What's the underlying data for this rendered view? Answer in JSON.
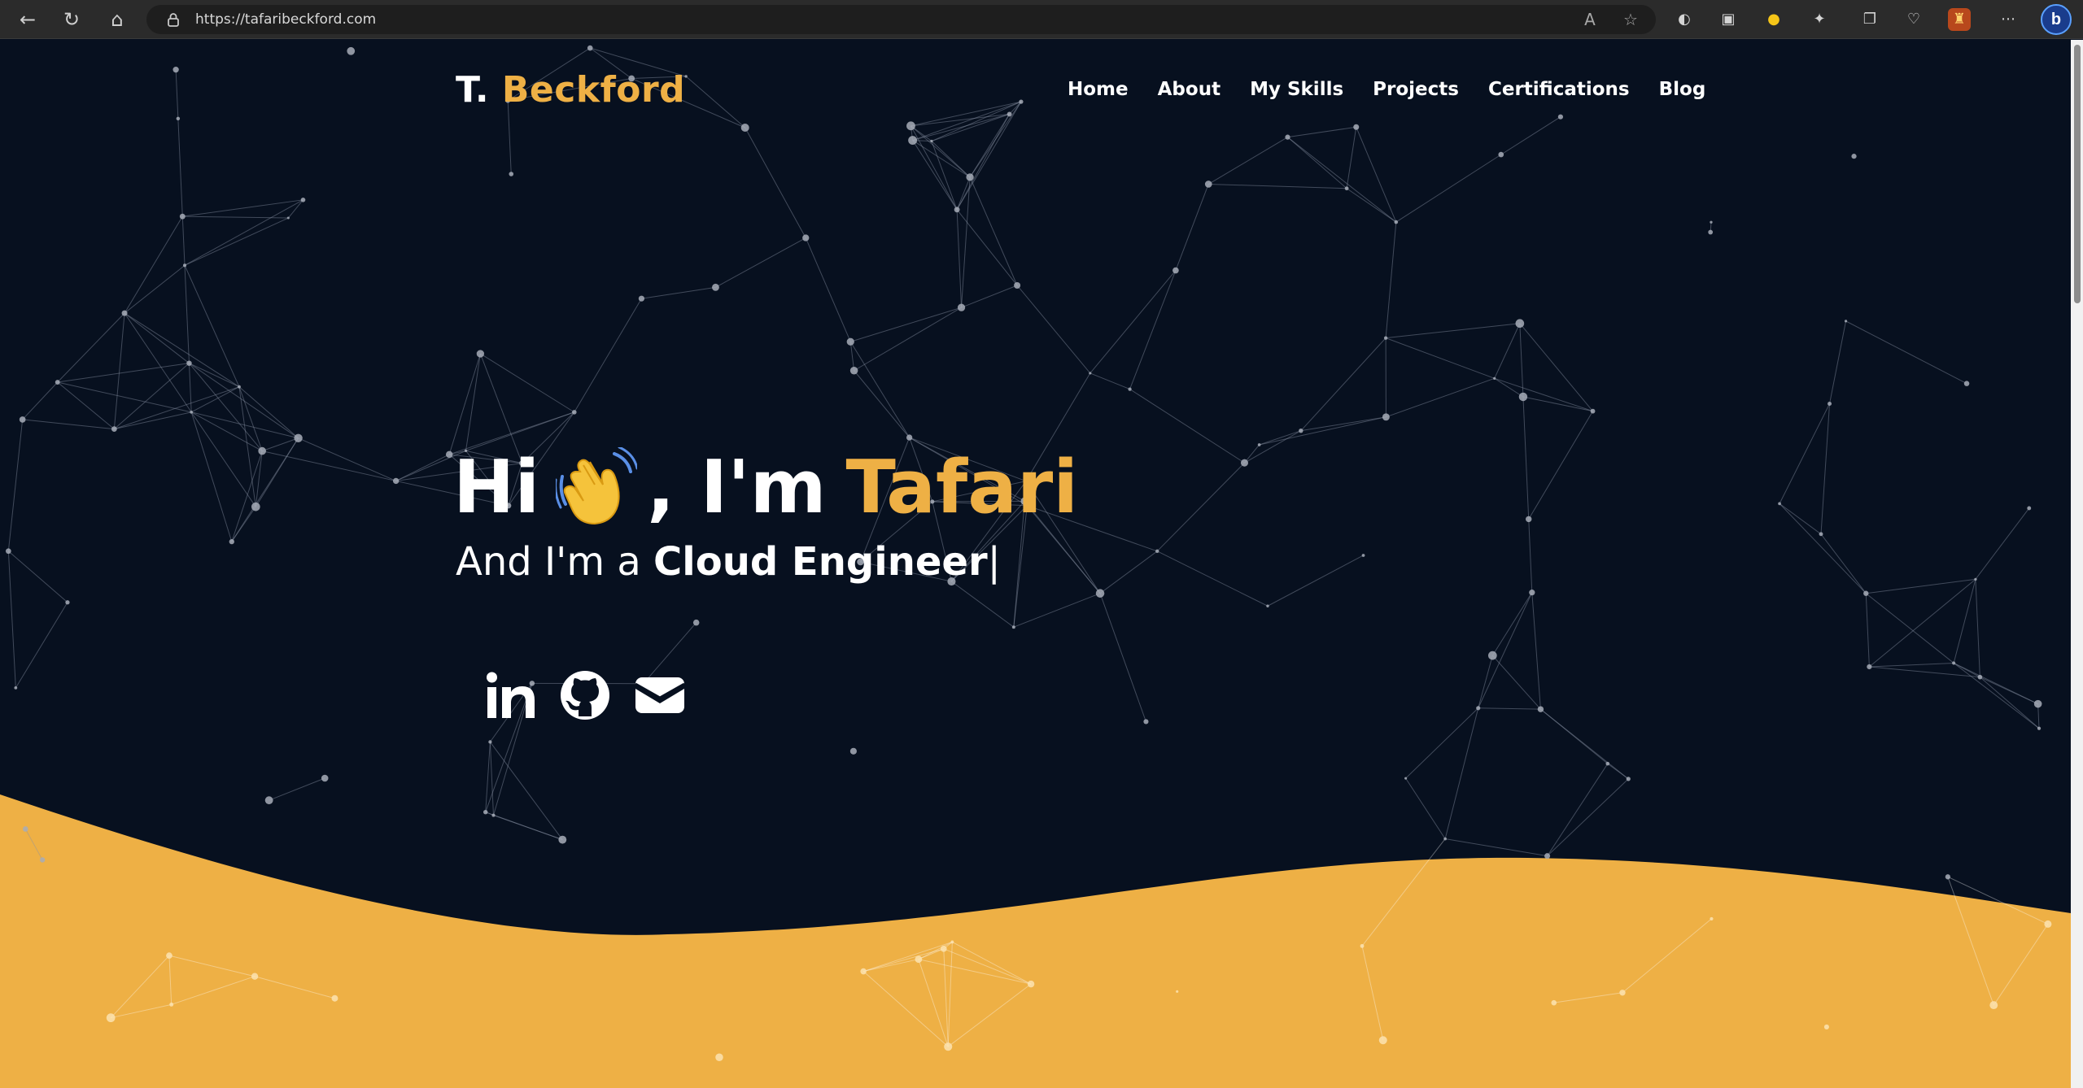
{
  "browser": {
    "url": "https://tafaribeckford.com",
    "icons": [
      "back-arrow-icon",
      "refresh-icon",
      "home-icon",
      "lock-icon",
      "read-aloud-icon",
      "favorite-star-icon",
      "extension-icons",
      "more-icon",
      "bing-icon"
    ]
  },
  "site": {
    "brand_first": "T.",
    "brand_last": "Beckford",
    "nav": [
      "Home",
      "About",
      "My Skills",
      "Projects",
      "Certifications",
      "Blog"
    ],
    "hero": {
      "greeting": "Hi",
      "connector": ", I'm",
      "name": "Tafari",
      "subtitle_prefix": "And I'm a",
      "role": "Cloud Engineer",
      "cursor": "|"
    },
    "social_icons": [
      "linkedin-icon",
      "github-icon",
      "email-icon"
    ]
  },
  "colors": {
    "background": "#07101f",
    "accent": "#eeb045",
    "text": "#ffffff",
    "network_line": "#8a93a3"
  }
}
